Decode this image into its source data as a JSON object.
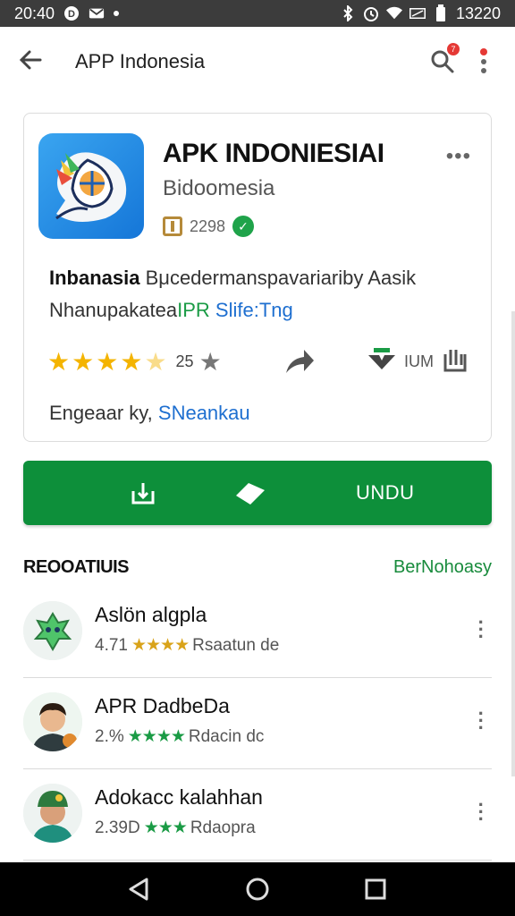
{
  "status_bar": {
    "time": "20:40",
    "right_time": "13220"
  },
  "app_bar": {
    "title": "APP Indonesia",
    "search_badge": "7"
  },
  "app": {
    "name": "APK INDONIESIAI",
    "developer": "Bidoomesia",
    "meta_value": "2298",
    "desc_bold": "Inbanasia",
    "desc_text": " Bμcedermanspavariariby Aasik",
    "desc_line2_prefix": "Nhanupakatea",
    "desc_green": "IPR",
    "desc_blue": " Slife:Tng",
    "rating_count": "25",
    "size_label": "IUM",
    "engagement_prefix": "Engeaar ky,",
    "engagement_link": " SNeankau"
  },
  "install_button": {
    "label": "UNDU",
    "color": "#0d8f3a"
  },
  "recommendations": {
    "title": "REOOATIUIS",
    "link": "BerNohoasy",
    "items": [
      {
        "name": "Aslön algpla",
        "rating": "4.71",
        "stars": "★★★★",
        "suffix": "Rsaatun de"
      },
      {
        "name": "APR DadbeDa",
        "rating": "2.%",
        "stars": "★★★★",
        "suffix": "Rdacin dc"
      },
      {
        "name": "Adokacc kalahhan",
        "rating": "2.39D",
        "stars": "★★★",
        "suffix": "Rdaopra"
      }
    ]
  },
  "icons": {
    "back": "arrow-left-icon",
    "search": "search-icon",
    "menu": "more-vert-icon",
    "nav_back": "triangle-back-icon",
    "nav_home": "circle-home-icon",
    "nav_recent": "square-recent-icon"
  }
}
